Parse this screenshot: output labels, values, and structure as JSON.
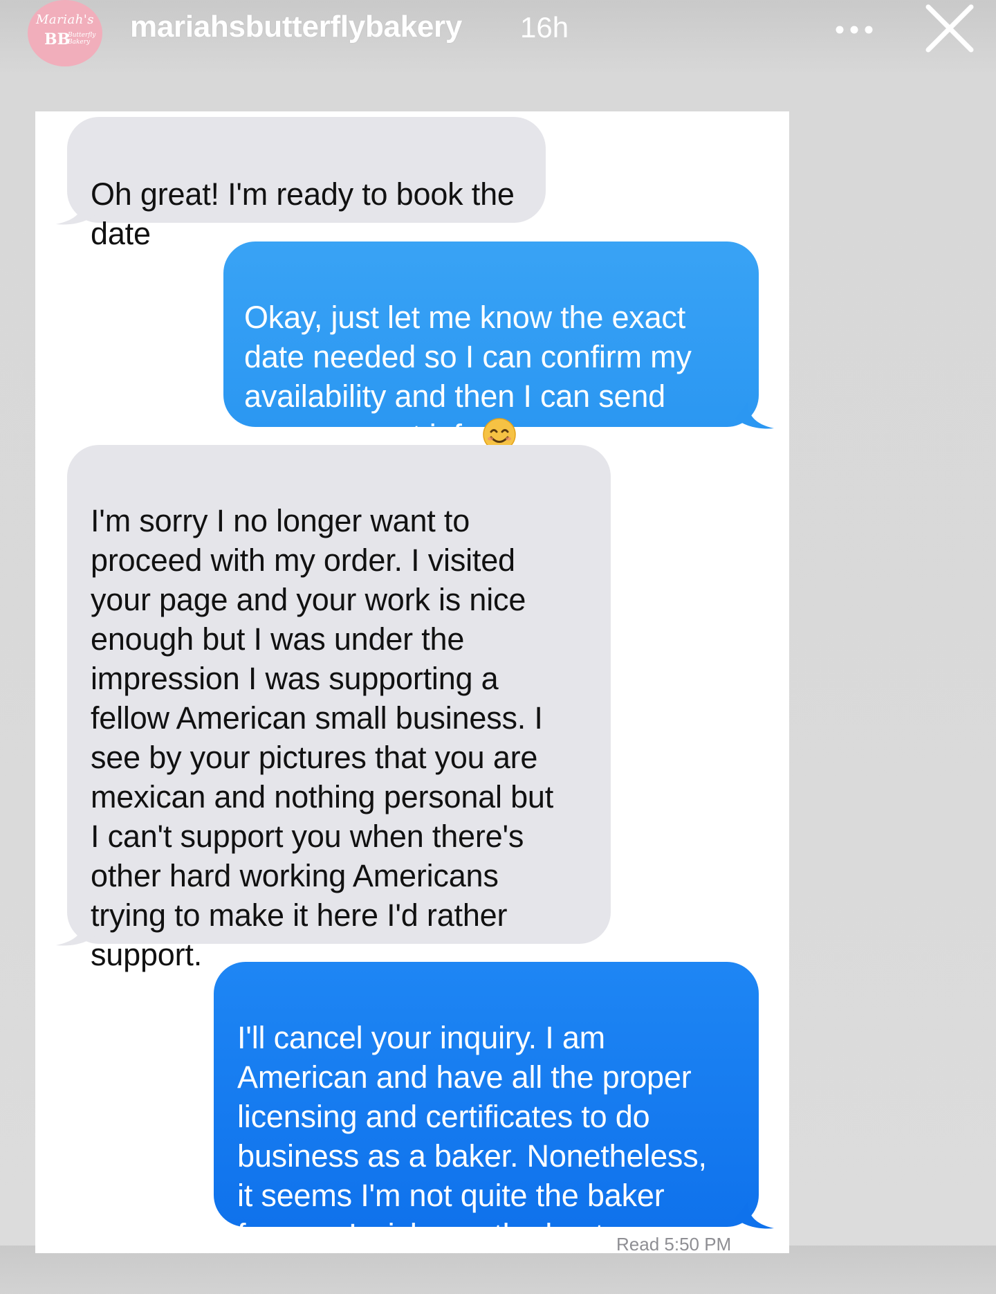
{
  "story": {
    "avatar": {
      "script_text": "Mariah's",
      "monogram": "BB",
      "small_text": "Butterfly Bakery"
    },
    "username": "mariahsbutterflybakery",
    "time_ago": "16h",
    "more_icon": "more-horizontal-icon",
    "close_icon": "close-icon"
  },
  "messages": [
    {
      "direction": "received",
      "text": "Oh great! I'm ready to book the\ndate"
    },
    {
      "direction": "sent",
      "text": "Okay, just let me know the exact\ndate needed so I can confirm my\navailability and then I can send\nyou payment info",
      "emoji": "smiling-face-emoji"
    },
    {
      "direction": "received",
      "text": "I'm sorry I no longer want to\nproceed with my order. I visited\nyour page and your work is nice\nenough but I was under the\nimpression I was supporting  a\nfellow American small business. I\nsee by your pictures that you are\nmexican and nothing personal but\nI can't support you when there's\nother hard working Americans\ntrying to make it here I'd rather\nsupport."
    },
    {
      "direction": "sent",
      "text": "I'll cancel your inquiry. I am\nAmerican and have all the proper\nlicensing and certificates to do\nbusiness as a baker. Nonetheless,\nit seems I'm not quite the baker\nfor you. I wish you the best."
    }
  ],
  "delivered_label": "Read 5:50 PM",
  "colors": {
    "received_bubble": "#e5e5ea",
    "sent_bubble_light": "#2b97f2",
    "sent_bubble_dark": "#0f72ec",
    "avatar_pink": "#f1aebb"
  }
}
